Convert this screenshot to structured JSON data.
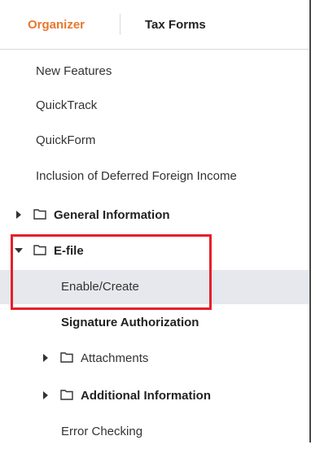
{
  "tabs": {
    "organizer": "Organizer",
    "tax_forms": "Tax Forms"
  },
  "tree": {
    "new_features": "New Features",
    "quicktrack": "QuickTrack",
    "quickform": "QuickForm",
    "inclusion": "Inclusion of Deferred Foreign Income",
    "general_information": "General Information",
    "efile": "E-file",
    "enable_create": "Enable/Create",
    "signature_authorization": "Signature Authorization",
    "attachments": "Attachments",
    "additional_information": "Additional Information",
    "error_checking": "Error Checking"
  },
  "colors": {
    "accent": "#e8772e",
    "highlight": "#e4202a",
    "selected_bg": "#e6e8ed"
  },
  "icons": {
    "collapsed": "caret-right-icon",
    "expanded": "caret-down-icon",
    "folder": "folder-icon"
  }
}
